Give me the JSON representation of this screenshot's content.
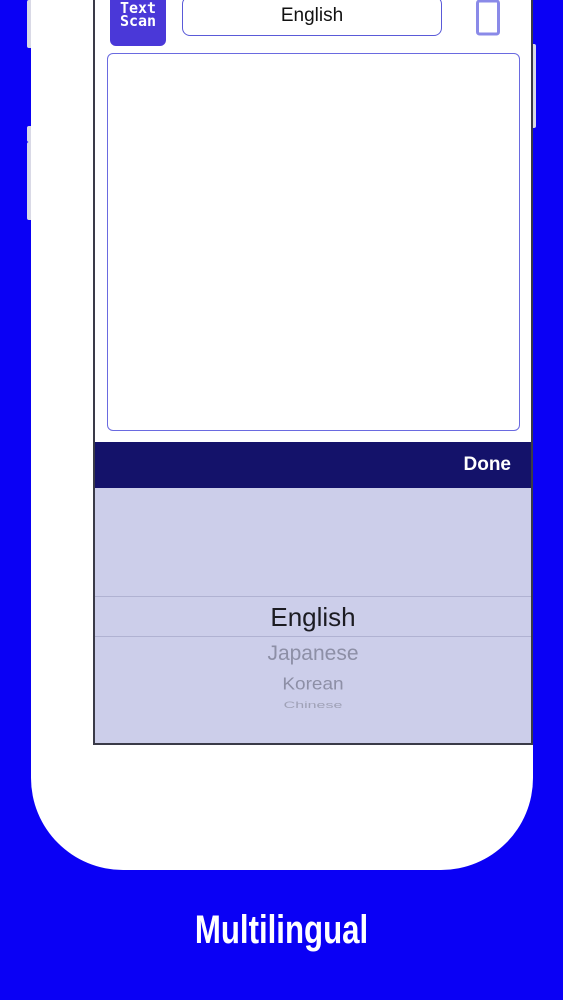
{
  "app": {
    "logo_line1": "Text",
    "logo_line2": "Scan"
  },
  "header": {
    "language_value": "English"
  },
  "toolbar": {
    "done_label": "Done"
  },
  "picker": {
    "selected": "English",
    "options": [
      "English",
      "Japanese",
      "Korean",
      "Chinese"
    ]
  },
  "caption": "Multilingual",
  "colors": {
    "background": "#0a00f5",
    "toolbar": "#14126a",
    "picker_bg": "#ccceea",
    "accent": "#5a5ad8"
  },
  "icons": {
    "trash": "trash-icon"
  }
}
